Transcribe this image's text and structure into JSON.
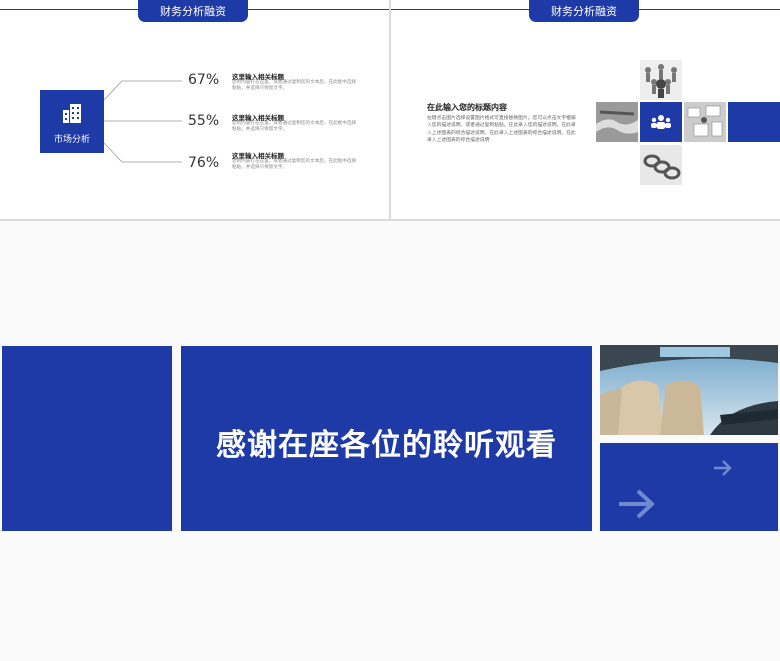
{
  "slide1": {
    "header_tab": "财务分析融资",
    "center_label": "市场分析",
    "center_icon": "buildings-icon",
    "items": [
      {
        "percent": "67%",
        "title": "这里输入相关标题",
        "desc": "您的内容打在这里，或者通过复制您的文本后，在此框中选择粘贴，并选择只保留文字。"
      },
      {
        "percent": "55%",
        "title": "这里输入相关标题",
        "desc": "您的内容打在这里，或者通过复制您的文本后，在此框中选择粘贴，并选择只保留文字。"
      },
      {
        "percent": "76%",
        "title": "这里输入相关标题",
        "desc": "您的内容打在这里，或者通过复制您的文本后，在此框中选择粘贴，并选择只保留文字。"
      }
    ],
    "accent": "#1e3aa6"
  },
  "slide2": {
    "header_tab": "财务分析融资",
    "title": "在此输入您的标题内容",
    "desc": "右键点击图片选择设置图片格式可直接替换图片。您可以点击文字框输入您的描述说明，或者通过复制粘贴。在此录入您的描述说明。在此录入上述图表的综合描述说明，在此录入上述图表的综合描述说明。在此录入上述图表的综合描述说明",
    "center_icon": "team-icon"
  },
  "slide3": {
    "thanks": "感谢在座各位的聆听观看",
    "arrow_icon": "arrow-right-icon"
  }
}
